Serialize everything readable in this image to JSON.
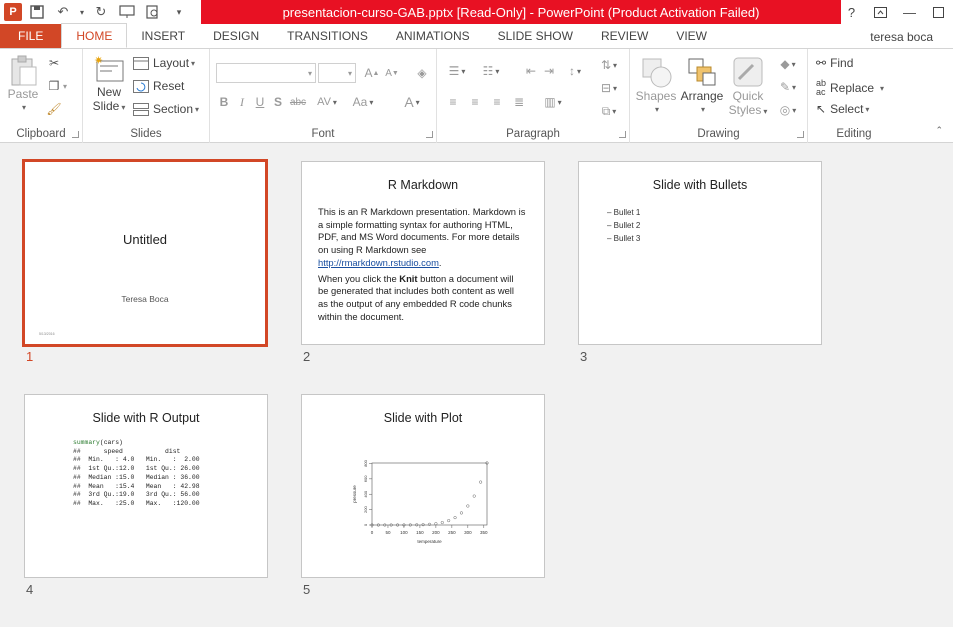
{
  "window": {
    "title": "presentacion-curso-GAB.pptx [Read-Only] -  PowerPoint (Product Activation Failed)",
    "app_icon": "P",
    "help": "?"
  },
  "tabs": [
    "FILE",
    "HOME",
    "INSERT",
    "DESIGN",
    "TRANSITIONS",
    "ANIMATIONS",
    "SLIDE SHOW",
    "REVIEW",
    "VIEW"
  ],
  "user": "teresa boca",
  "ribbon": {
    "clipboard": {
      "paste": "Paste",
      "label": "Clipboard"
    },
    "slides": {
      "new_slide_1": "New",
      "new_slide_2": "Slide",
      "layout": "Layout",
      "reset": "Reset",
      "section": "Section",
      "label": "Slides"
    },
    "font": {
      "bold": "B",
      "italic": "I",
      "underline": "U",
      "shadow": "S",
      "strike": "abc",
      "spacing": "AV",
      "case": "Aa",
      "color": "A",
      "grow": "A",
      "shrink": "A",
      "label": "Font"
    },
    "paragraph": {
      "label": "Paragraph"
    },
    "drawing": {
      "shapes": "Shapes",
      "arrange": "Arrange",
      "quick_1": "Quick",
      "quick_2": "Styles",
      "label": "Drawing"
    },
    "editing": {
      "find": "Find",
      "replace": "Replace",
      "select": "Select",
      "label": "Editing"
    }
  },
  "slides": [
    {
      "num": "1",
      "title": "Untitled",
      "subtitle": "Teresa Boca",
      "date": "5/13/2016"
    },
    {
      "num": "2",
      "title": "R Markdown",
      "para1_a": "This is an R Markdown presentation. Markdown is a simple formatting syntax for authoring HTML, PDF, and MS Word documents. For more details on using R Markdown see ",
      "para1_link": "http://rmarkdown.rstudio.com",
      "para1_b": ".",
      "para2_a": "When you click the ",
      "para2_bold": "Knit",
      "para2_b": " button a document will be generated that includes both content as well as the output of any embedded R code chunks within the document."
    },
    {
      "num": "3",
      "title": "Slide with Bullets",
      "bullets": [
        "Bullet 1",
        "Bullet 2",
        "Bullet 3"
      ]
    },
    {
      "num": "4",
      "title": "Slide with R Output",
      "code_fn": "summary",
      "code_arg": "(cars)",
      "code_lines": [
        "##      speed           dist",
        "##  Min.   : 4.0   Min.   :  2.00",
        "##  1st Qu.:12.0   1st Qu.: 26.00",
        "##  Median :15.0   Median : 36.00",
        "##  Mean   :15.4   Mean   : 42.98",
        "##  3rd Qu.:19.0   3rd Qu.: 56.00",
        "##  Max.   :25.0   Max.   :120.00"
      ]
    },
    {
      "num": "5",
      "title": "Slide with Plot"
    }
  ],
  "chart_data": {
    "type": "scatter",
    "xlabel": "temperature",
    "ylabel": "pressure",
    "xticks": [
      "0",
      "50",
      "100",
      "150",
      "200",
      "250",
      "300",
      "350"
    ],
    "yticks": [
      "0",
      "200",
      "400",
      "600",
      "800"
    ],
    "xlim": [
      0,
      360
    ],
    "ylim": [
      0,
      806
    ],
    "x": [
      0,
      20,
      40,
      60,
      80,
      100,
      120,
      140,
      160,
      180,
      200,
      220,
      240,
      260,
      280,
      300,
      320,
      340,
      360
    ],
    "y": [
      0.0002,
      0.0012,
      0.006,
      0.03,
      0.09,
      0.27,
      0.75,
      1.85,
      4.2,
      8.8,
      17.3,
      32.1,
      57,
      96,
      157,
      247,
      376,
      558,
      806
    ]
  },
  "colors": {
    "accent": "#d24726",
    "title_bar": "#e81123",
    "sorter_bg": "#f1f1f1"
  }
}
